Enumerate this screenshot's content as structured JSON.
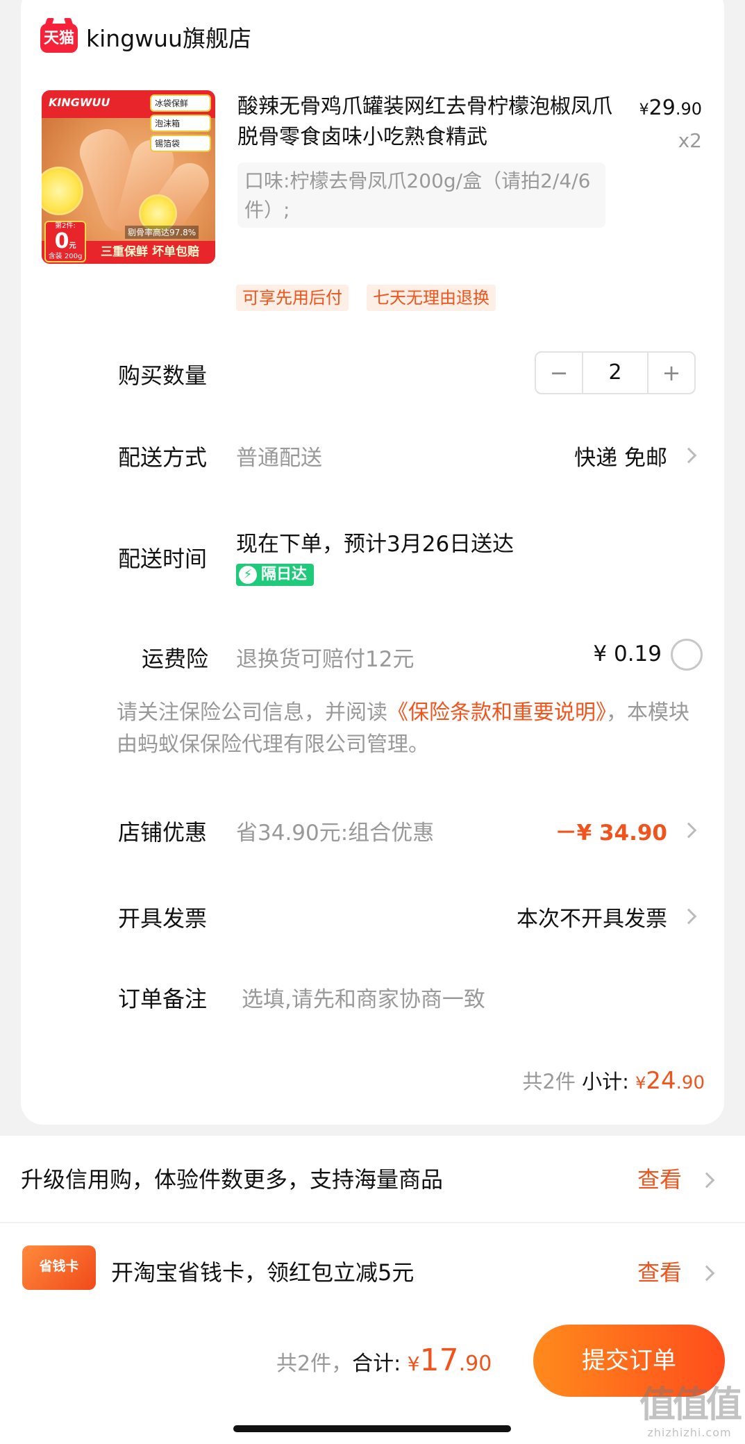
{
  "store": {
    "logo_text": "天猫",
    "name": "kingwuu旗舰店"
  },
  "product": {
    "image": {
      "brand": "KINGWUU",
      "tags": [
        "冰袋保鲜",
        "泡沫箱",
        "锡箔袋"
      ],
      "rate_text": "剔骨率高达97.8%",
      "banner": "三重保鲜 坏单包赔",
      "second_item_label": "第2件:",
      "second_item_price": "0",
      "second_item_unit": "元",
      "second_item_note": "含装 200g"
    },
    "title": "酸辣无骨鸡爪罐装网红去骨柠檬泡椒凤爪脱骨零食卤味小吃熟食精武",
    "price_symbol": "¥",
    "price_int": "29",
    "price_dec": ".90",
    "quantity_text": "x2",
    "sku": "口味:柠檬去骨凤爪200g/盒（请拍2/4/6件）;",
    "badges": [
      "可享先用后付",
      "七天无理由退换"
    ]
  },
  "quantity": {
    "label": "购买数量",
    "minus": "−",
    "value": "2",
    "plus": "+"
  },
  "delivery": {
    "label": "配送方式",
    "value": "普通配送",
    "right": "快递 免邮"
  },
  "delivery_time": {
    "label": "配送时间",
    "value": "现在下单，预计3月26日送达",
    "badge_icon": "⚡",
    "badge": "隔日达"
  },
  "insurance": {
    "label": "运费险",
    "value": "退换货可赔付12元",
    "price": "¥ 0.19",
    "note_prefix": "请关注保险公司信息，并阅读",
    "note_link": "《保险条款和重要说明》",
    "note_suffix": "，本模块由蚂蚁保保险代理有限公司管理。"
  },
  "store_discount": {
    "label": "店铺优惠",
    "value": "省34.90元:组合优惠",
    "amount": "－¥ 34.90"
  },
  "invoice": {
    "label": "开具发票",
    "value": "本次不开具发票"
  },
  "remark": {
    "label": "订单备注",
    "placeholder": "选填,请先和商家协商一致"
  },
  "subtotal": {
    "count": "共2件",
    "label": "小计:",
    "symbol": "¥",
    "int": "24",
    "dec": ".90"
  },
  "credit": {
    "text": "升级信用购，体验件数更多，支持海量商品",
    "action": "查看"
  },
  "savecard": {
    "icon_text": "省钱卡",
    "text": "开淘宝省钱卡，领红包立减5元",
    "action": "查看"
  },
  "footer": {
    "count": "共2件，",
    "label": "合计:",
    "symbol": "¥",
    "int": "17",
    "dec": ".90",
    "submit": "提交订单"
  },
  "watermark": {
    "big": "值值值",
    "small": "zhizhizhi.com"
  },
  "colors": {
    "accent": "#f0541c",
    "tmall_red": "#f5223a",
    "nextday_green": "#1fcb7b"
  }
}
